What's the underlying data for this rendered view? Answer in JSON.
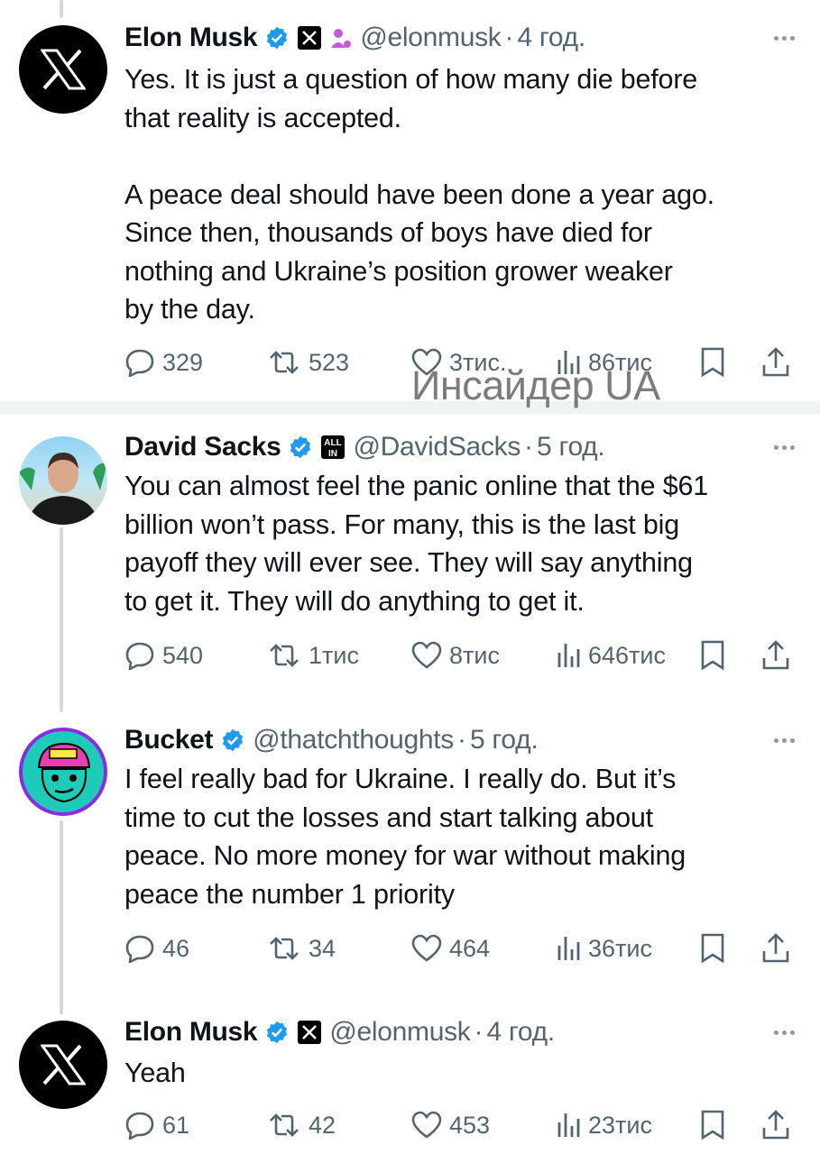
{
  "watermark": "Инсайдер UA",
  "colors": {
    "verified": "#1d9bf0",
    "text": "#0f1419",
    "muted": "#536471",
    "line": "#cfd9de"
  },
  "tweets": [
    {
      "name": "Elon Musk",
      "handle": "@elonmusk",
      "dot": "·",
      "time": "4 год.",
      "text": "Yes. It is just a question of how many die before\nthat reality is accepted.\n\nA peace deal should have been done a year ago.\nSince then, thousands of boys have died for\nnothing and Ukraine’s position grower weaker\nby the day.",
      "replies": "329",
      "retweets": "523",
      "likes": "3тис.",
      "views": "86тис"
    },
    {
      "name": "David Sacks",
      "handle": "@DavidSacks",
      "dot": "·",
      "time": "5 год.",
      "affiliate_badge": "ALL IN",
      "text": "You can almost feel the panic online that the $61\nbillion won’t pass. For many, this is the last big\npayoff they will ever see. They will say anything\nto get it. They will do anything to get it.",
      "replies": "540",
      "retweets": "1тис",
      "likes": "8тис",
      "views": "646тис"
    },
    {
      "name": "Bucket",
      "handle": "@thatchthoughts",
      "dot": "·",
      "time": "5 год.",
      "text": "I feel really bad for Ukraine. I really do. But it’s\ntime to cut the losses and start talking about\npeace. No more money for war without making\npeace the number 1 priority",
      "replies": "46",
      "retweets": "34",
      "likes": "464",
      "views": "36тис"
    },
    {
      "name": "Elon Musk",
      "handle": "@elonmusk",
      "dot": "·",
      "time": "4 год.",
      "text": "Yeah",
      "replies": "61",
      "retweets": "42",
      "likes": "453",
      "views": "23тис"
    }
  ]
}
